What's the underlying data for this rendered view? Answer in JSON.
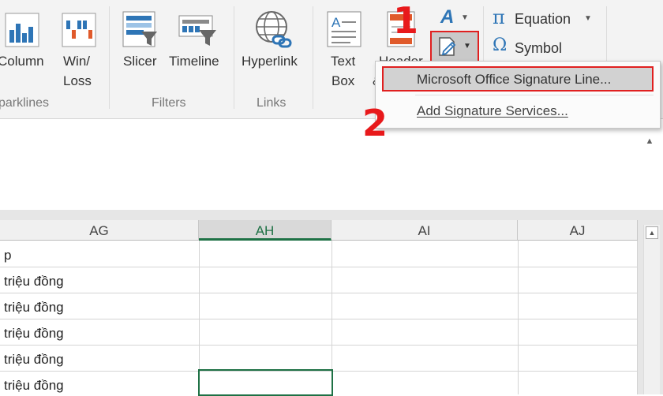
{
  "ribbon": {
    "sparklines": {
      "column_label": "Column",
      "winloss_label_1": "Win/",
      "winloss_label_2": "Loss",
      "group_label": "parklines"
    },
    "filters": {
      "slicer_label": "Slicer",
      "timeline_label": "Timeline",
      "group_label": "Filters"
    },
    "links": {
      "hyperlink_label": "Hyperlink",
      "group_label": "Links"
    },
    "text": {
      "textbox_label_1": "Text",
      "textbox_label_2": "Box",
      "header_label_1": "Header",
      "header_label_2": "&"
    },
    "symbols": {
      "equation_label": "Equation",
      "symbol_label": "Symbol"
    }
  },
  "dropdown": {
    "items": [
      {
        "label": "Microsoft Office Signature Line..."
      },
      {
        "label": "Add Signature Services..."
      }
    ]
  },
  "steps": {
    "one": "1",
    "two": "2"
  },
  "grid": {
    "columns": [
      {
        "label": "AG"
      },
      {
        "label": "AH",
        "selected": true
      },
      {
        "label": "AI"
      },
      {
        "label": "AJ"
      }
    ],
    "rows": [
      "p",
      "triệu đồng",
      "triệu đồng",
      "triệu đồng",
      "triệu đồng",
      "triệu đồng"
    ]
  },
  "colors": {
    "accent_green": "#1e7145",
    "highlight_red": "#e02020",
    "step_red": "#e8191b"
  },
  "icons": [
    "column-sparkline-icon",
    "winloss-sparkline-icon",
    "slicer-icon",
    "timeline-icon",
    "hyperlink-globe-icon",
    "textbox-icon",
    "header-footer-icon",
    "wordart-icon",
    "signature-line-icon",
    "equation-pi-icon",
    "symbol-omega-icon"
  ]
}
